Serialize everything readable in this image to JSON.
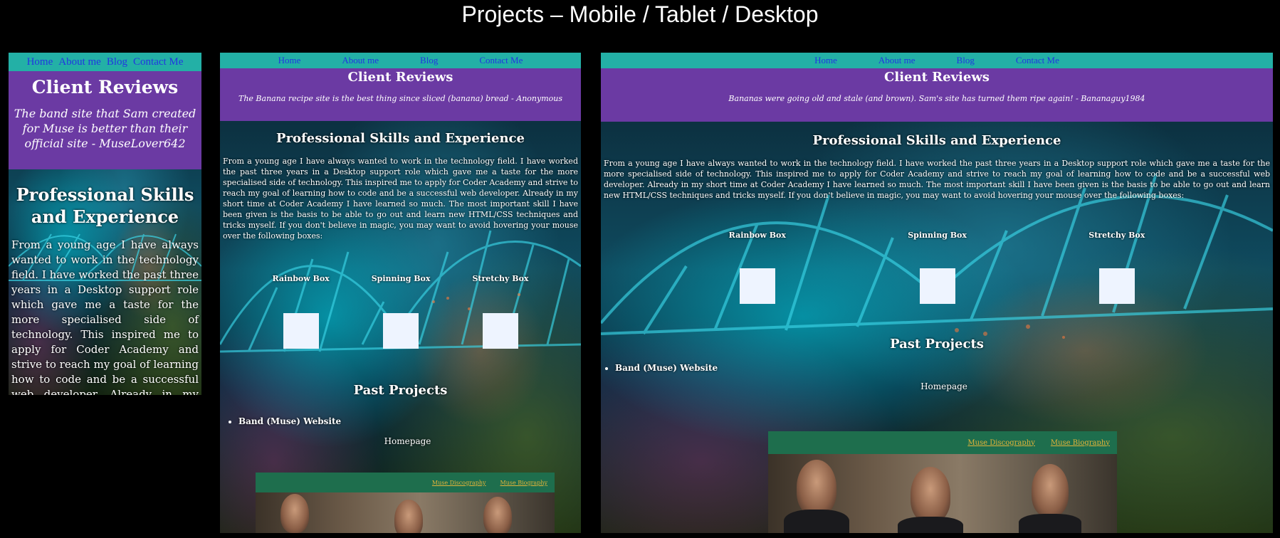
{
  "title": "Projects – Mobile / Tablet / Desktop",
  "nav": [
    "Home",
    "About me",
    "Blog",
    "Contact Me"
  ],
  "reviews_heading": "Client Reviews",
  "mobile": {
    "review": "The band site that Sam created for Muse is better than their official site - MuseLover642"
  },
  "tablet": {
    "review": "The Banana recipe site is the best thing since sliced (banana) bread - Anonymous"
  },
  "desktop": {
    "review": "Bananas were going old and stale (and brown). Sam's site has turned them ripe again! - Bananaguy1984"
  },
  "skills_heading": "Professional Skills and Experience",
  "skills_text": "From a young age I have always wanted to work in the technology field. I have worked the past three years in a Desktop support role which gave me a taste for the more specialised side of technology. This inspired me to apply for Coder Academy and strive to reach my goal of learning how to code and be a successful web developer. Already in my short time at Coder Academy I have learned so much. The most important skill I have been given is the basis to be able to go out and learn new HTML/CSS techniques and tricks myself. If you don't believe in magic, you may want to avoid hovering your mouse over the following boxes:",
  "boxes": [
    "Rainbow Box",
    "Spinning Box",
    "Stretchy Box"
  ],
  "projects_heading": "Past Projects",
  "project_item": "Band (Muse) Website",
  "homepage_label": "Homepage",
  "preview_links": [
    "Muse Discography",
    "Muse Biography"
  ],
  "colors": {
    "nav": "#23b0a6",
    "reviews": "#6b3aa3",
    "nav_link": "#2236e0",
    "preview_nav": "#1e6e4d",
    "preview_link": "#e2b43a"
  }
}
